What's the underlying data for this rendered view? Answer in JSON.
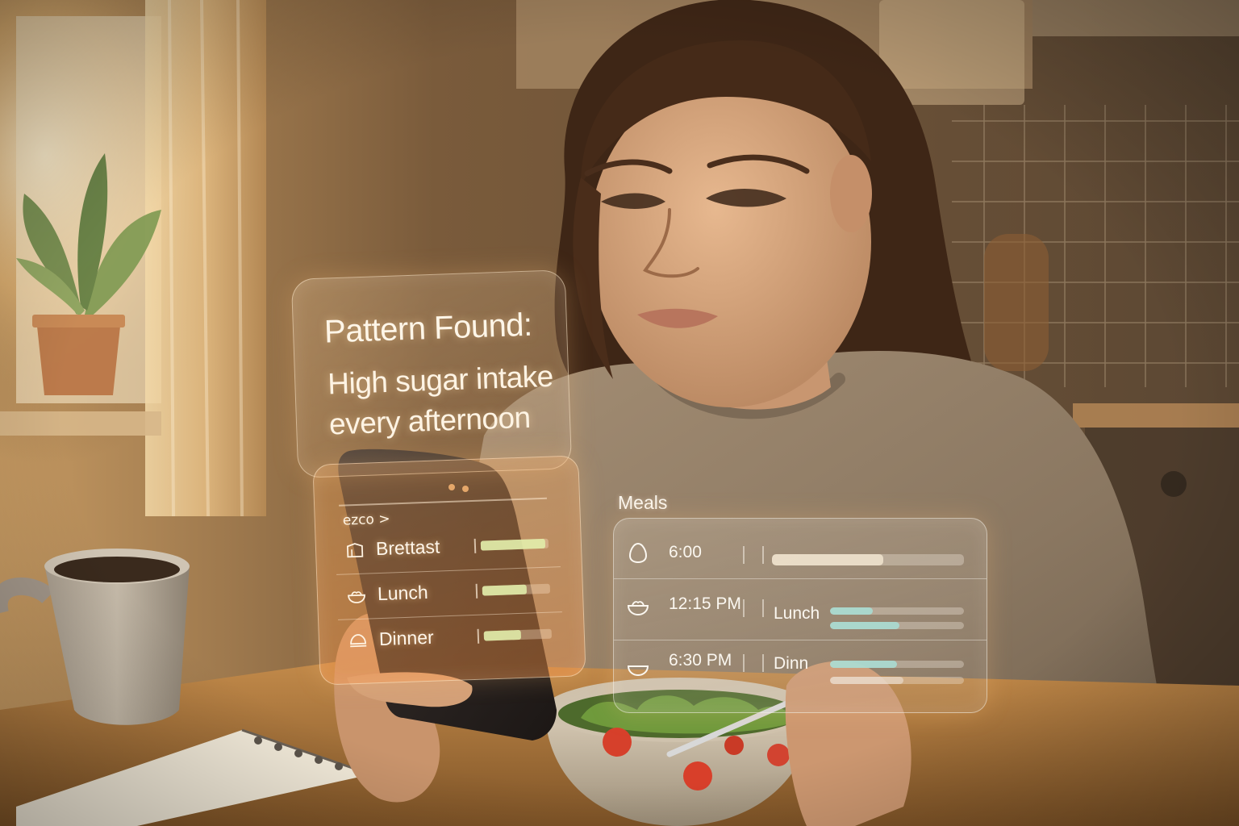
{
  "pattern_card": {
    "title": "Pattern Found:",
    "body": "High sugar intake every afternoon"
  },
  "phone_app": {
    "breadcrumb": "ezco >",
    "rows": [
      {
        "label": "Brettast",
        "icon": "bread-icon",
        "level": 0.95
      },
      {
        "label": "Lunch",
        "icon": "bowl-icon",
        "level": 0.65
      },
      {
        "label": "Dinner",
        "icon": "dome-icon",
        "level": 0.55
      }
    ]
  },
  "meals_panel": {
    "label": "Meals",
    "rows": [
      {
        "time": "6:00",
        "name": "",
        "icon": "egg-icon",
        "bars": [
          0.58
        ]
      },
      {
        "time": "12:15 PM",
        "name": "Lunch",
        "icon": "bowl-icon",
        "bars": [
          0.32,
          0.52
        ]
      },
      {
        "time": "6:30 PM",
        "name": "Dinn",
        "icon": "bowl-icon",
        "bars": [
          0.5,
          0.55
        ]
      }
    ]
  },
  "colors": {
    "warm_light": "#f4b66a",
    "wall": "#5a4430",
    "sweater": "#8c7a66",
    "hair": "#3b2416",
    "table": "#a8763f",
    "bar_fill_green": "#e2f0aa",
    "bar_fill_teal": "#a8dcd2"
  }
}
